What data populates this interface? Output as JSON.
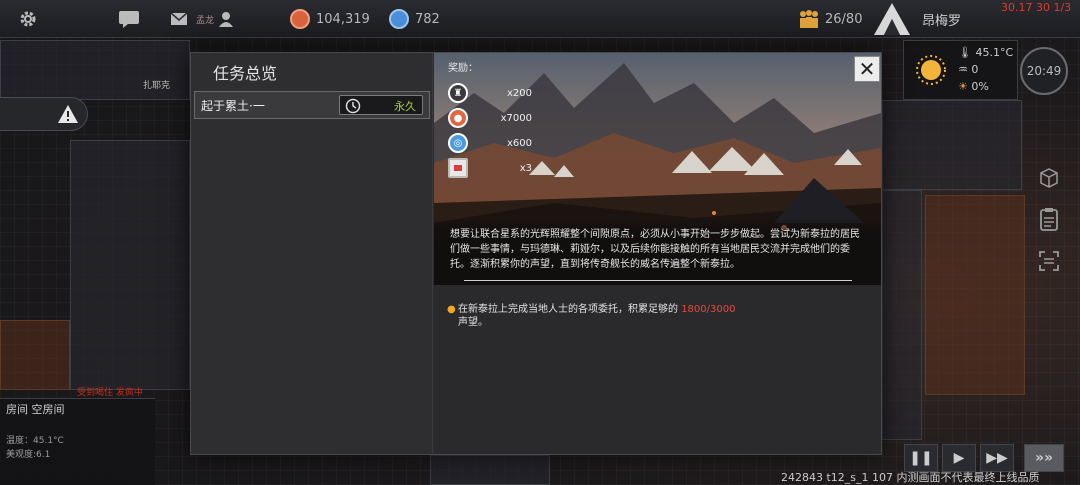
{
  "topbar": {
    "settings_icon": "gear-icon",
    "chat_icon": "chat-icon",
    "mail_icon": "mail-icon",
    "player_name": "孟龙",
    "player_icon": "person-icon",
    "resource1_value": "104,319",
    "resource1_color": "#d9633e",
    "resource2_value": "782",
    "resource2_color": "#4a8fd8",
    "population_value": "26/80",
    "population_icon": "people-icon",
    "planet_name": "昂梅罗",
    "debug_text": "30.17 30 1/3"
  },
  "left_panel": {
    "alert_icon": "warning-icon",
    "map_label": "扎耶克",
    "status_red": "受到喝住 发疯中",
    "room_title": "房间 空房间",
    "temperature": "温度：45.1°C",
    "beauty": "美观度:6.1"
  },
  "hud": {
    "temperature": "45.1°C",
    "humidity": "0",
    "light": "0%",
    "time": "20:49",
    "weather_icon": "sun-icon"
  },
  "modal": {
    "title": "任务总览",
    "close_icon": "close-icon",
    "quest": {
      "name": "起于累土·一",
      "timer_icon": "clock-icon",
      "duration": "永久"
    },
    "rewards_label": "奖励：",
    "rewards": [
      {
        "icon": "reputation-icon",
        "amount": "x200",
        "color": "#cfcfcf"
      },
      {
        "icon": "credits-icon",
        "amount": "x7000",
        "color": "#e0673f"
      },
      {
        "icon": "tech-icon",
        "amount": "x600",
        "color": "#4a9be0"
      },
      {
        "icon": "item-icon",
        "amount": "x3",
        "color": "#d84040"
      }
    ],
    "description": "想要让联合星系的光辉照耀整个间隙原点，必须从小事开始一步步做起。尝试为新泰拉的居民们做一些事情，与玛德琳、莉娅尔，以及后续你能接触的所有当地居民交流并完成他们的委托。逐渐积累你的声望，直到将传奇舰长的威名传遍整个新泰拉。",
    "objective_before": "在新泰拉上完成当地人士的各项委托，积累足够的",
    "objective_progress": "1800/3000",
    "objective_after": "声望。"
  },
  "controls": {
    "pause_icon": "pause-icon",
    "play_icon": "play-icon",
    "fast_icon": "fast-forward-icon",
    "faster_icon": "faster-forward-icon"
  },
  "footer": {
    "build_info": "242843 t12_s_1 107  内测画面不代表最终上线品质"
  }
}
